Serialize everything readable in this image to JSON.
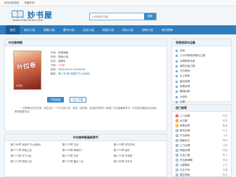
{
  "topbar": {
    "links": [
      "用本站前首页",
      "收藏本站"
    ]
  },
  "header": {
    "logo_title": "妙书屋",
    "logo_url": "www.miaoshuwu.com",
    "search_placeholder": "小说名称 作者",
    "search_button": "搜索"
  },
  "nav": {
    "items": [
      "首页",
      "玄幻小说",
      "修真小说",
      "都市小说",
      "历史小说",
      "网游小说",
      "科幻小说",
      "恐怖小说",
      "排行榜单"
    ]
  },
  "book": {
    "panel_title": "叶拉卷神殿",
    "cover_title": "叶拉卷",
    "cover_author": "风萧萧",
    "author_label": "作者：",
    "author": "执慧阅读",
    "category_label": "类别：",
    "category": "其他小说",
    "status_label": "状态：",
    "status": "连载中",
    "words_label": "字数：",
    "words": "1万字",
    "update_label": "更新：",
    "update": "2020-09-31 20:03:05",
    "latest_label": "最新：",
    "latest": "第1780章 貌建天下(大结局)",
    "read_btn": "开始阅读",
    "fav_btn": "加入书架",
    "intro": "一代神尊自天外归来，转生成了一个平凡的少年，而这一世的他，会选择怎样的一条路？叶拉卷最新章节，叶拉卷无弹窗全文阅读，敬请收藏本站。"
  },
  "chapters": {
    "title": "叶拉卷神殿最新章节",
    "items": [
      "第1780章 我欲天下(大结局)",
      "第1779章 决战",
      "第1778章 苍宇天帝",
      "第1777章 终极之战",
      "第1776章 神魂归一",
      "第1775章 破天",
      "第1774章 天下大乱",
      "第1773章 归来",
      "第1772章 天帝现",
      "第1771章 宿命之战",
      "第1770章 最后一战",
      "第1769章 天外天"
    ]
  },
  "side1": {
    "title": "免费阅读作品集",
    "items": [
      "仙术",
      "江小乐和他的修仙之路",
      "仙界修炼手册",
      "我的无敌之路",
      "万古神帝",
      "无上神帝",
      "盖世帝尊",
      "修罗武神",
      "最强仙尊",
      "天帝传",
      "元尊"
    ]
  },
  "side2": {
    "title": "热门推荐",
    "items": [
      {
        "rank": "1",
        "name": "上门龙婿",
        "author": "叶辰"
      },
      {
        "rank": "2",
        "name": "龙王殿",
        "author": "张宇"
      },
      {
        "rank": "3",
        "name": "修罗武神",
        "author": "善良"
      },
      {
        "rank": "4",
        "name": "都市至尊",
        "author": "叶凡"
      },
      {
        "rank": "5",
        "name": "万古神帝",
        "author": "飞天"
      },
      {
        "rank": "6",
        "name": "超级兵王",
        "author": "林风"
      },
      {
        "rank": "7",
        "name": "上门女婿",
        "author": "江辰"
      },
      {
        "rank": "8",
        "name": "神医狂婿",
        "author": "苏阳"
      },
      {
        "rank": "9",
        "name": "王者之路",
        "author": "陈平"
      },
      {
        "rank": "10",
        "name": "叶拉卷神殿",
        "author": "佚名"
      },
      {
        "rank": "11",
        "name": "九星霸体",
        "author": "平凡"
      },
      {
        "rank": "12",
        "name": "长生不死",
        "author": "天蚕"
      },
      {
        "rank": "13",
        "name": "重生神医",
        "author": "秋水"
      }
    ]
  }
}
